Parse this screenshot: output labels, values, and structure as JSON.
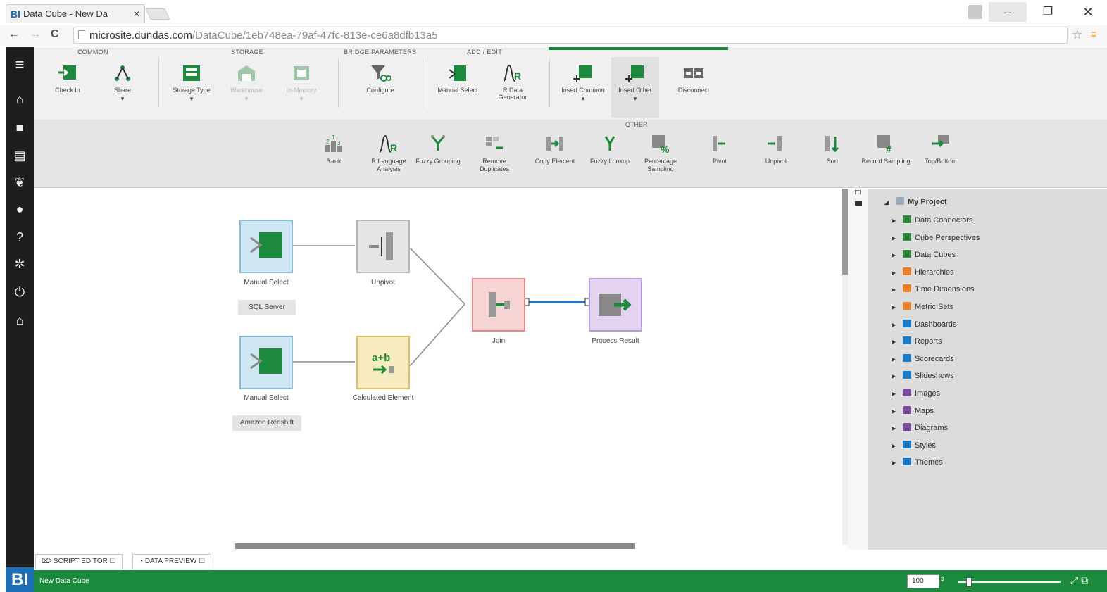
{
  "browser": {
    "tab_title": "Data Cube - New Da",
    "favicon": "BI",
    "url_host": "microsite.dundas.com",
    "url_path": "/DataCube/1eb748ea-79af-47fc-813e-ce6a8dfb13a5"
  },
  "ribbon": {
    "groups": [
      {
        "label": "COMMON"
      },
      {
        "label": "STORAGE"
      },
      {
        "label": "BRIDGE PARAMETERS"
      },
      {
        "label": "ADD / EDIT"
      }
    ],
    "buttons": [
      {
        "label": "Check In",
        "icon": "check-in-icon"
      },
      {
        "label": "Share",
        "icon": "share-icon"
      },
      {
        "label": "Storage Type",
        "icon": "storage-type-icon"
      },
      {
        "label": "Warehouse",
        "icon": "warehouse-icon"
      },
      {
        "label": "In-Memory",
        "icon": "in-memory-icon"
      },
      {
        "label": "Configure",
        "icon": "configure-icon"
      },
      {
        "label": "Manual Select",
        "icon": "manual-select-icon"
      },
      {
        "label": "R Data Generator",
        "icon": "r-data-generator-icon"
      },
      {
        "label": "Insert Common",
        "icon": "insert-common-icon"
      },
      {
        "label": "Insert Other",
        "icon": "insert-other-icon"
      },
      {
        "label": "Disconnect",
        "icon": "disconnect-icon"
      }
    ]
  },
  "other": {
    "label": "OTHER",
    "buttons": [
      {
        "label": "Rank"
      },
      {
        "label": "R Language Analysis"
      },
      {
        "label": "Fuzzy Grouping"
      },
      {
        "label": "Remove Duplicates"
      },
      {
        "label": "Copy Element"
      },
      {
        "label": "Fuzzy Lookup"
      },
      {
        "label": "Percentage Sampling"
      },
      {
        "label": "Pivot"
      },
      {
        "label": "Unpivot"
      },
      {
        "label": "Sort"
      },
      {
        "label": "Record Sampling"
      },
      {
        "label": "Top/Bottom"
      }
    ]
  },
  "diagram": {
    "nodes": [
      {
        "label": "Manual Select",
        "tag": "SQL Server"
      },
      {
        "label": "Unpivot"
      },
      {
        "label": "Manual Select",
        "tag": "Amazon Redshift"
      },
      {
        "label": "Calculated Element",
        "glyph": "a+b"
      },
      {
        "label": "Join"
      },
      {
        "label": "Process Result"
      }
    ]
  },
  "explorer": {
    "root": "My Project",
    "items": [
      {
        "label": "Data Connectors",
        "color": "#2e8b3e"
      },
      {
        "label": "Cube Perspectives",
        "color": "#2e8b3e"
      },
      {
        "label": "Data Cubes",
        "color": "#2e8b3e"
      },
      {
        "label": "Hierarchies",
        "color": "#e8812a"
      },
      {
        "label": "Time Dimensions",
        "color": "#e8812a"
      },
      {
        "label": "Metric Sets",
        "color": "#e8812a"
      },
      {
        "label": "Dashboards",
        "color": "#1c7bc4"
      },
      {
        "label": "Reports",
        "color": "#1c7bc4"
      },
      {
        "label": "Scorecards",
        "color": "#1c7bc4"
      },
      {
        "label": "Slideshows",
        "color": "#1c7bc4"
      },
      {
        "label": "Images",
        "color": "#7a4a9c"
      },
      {
        "label": "Maps",
        "color": "#7a4a9c"
      },
      {
        "label": "Diagrams",
        "color": "#7a4a9c"
      },
      {
        "label": "Styles",
        "color": "#1c7bc4"
      },
      {
        "label": "Themes",
        "color": "#1c7bc4"
      }
    ]
  },
  "bottom_tabs": [
    {
      "label": "SCRIPT EDITOR"
    },
    {
      "label": "DATA PREVIEW"
    }
  ],
  "status": {
    "title": "New Data Cube",
    "zoom": "100",
    "logo": "BI"
  },
  "colors": {
    "accent_green": "#1b8a3c",
    "sidebar": "#1e1e1e",
    "select_node": "#cfe6f3",
    "transform_node": "#e6e6e6",
    "join_node": "#f7d4d4",
    "calc_node": "#f7ecbf",
    "result_node": "#e3d3f1",
    "link_blue": "#1c7bc4"
  }
}
